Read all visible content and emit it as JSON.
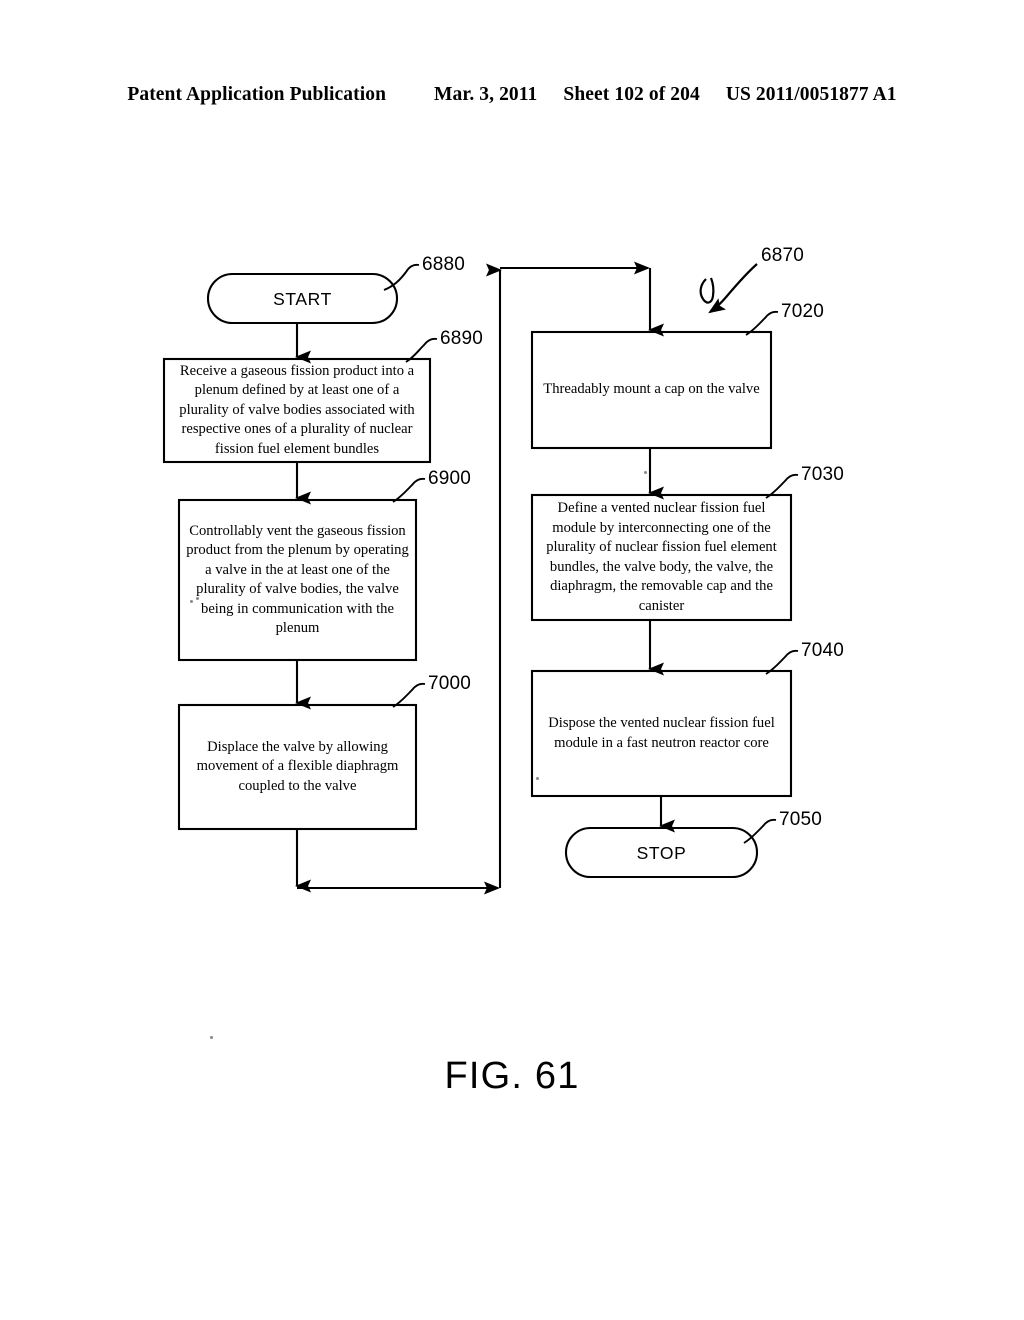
{
  "header": {
    "publication": "Patent Application Publication",
    "date": "Mar. 3, 2011",
    "sheet": "Sheet 102 of 204",
    "number": "US 2011/0051877 A1"
  },
  "figure": {
    "caption": "FIG. 61",
    "overall_ref": "6870"
  },
  "flowchart": {
    "nodes": [
      {
        "id": "start",
        "ref": "6880",
        "shape": "terminator",
        "text": "START"
      },
      {
        "id": "receive-gaseous-fission-product",
        "ref": "6890",
        "shape": "process",
        "text": "Receive a gaseous fission product into a plenum defined by at least one of a plurality of valve bodies associated with respective ones of a plurality of nuclear fission fuel element bundles"
      },
      {
        "id": "controllably-vent",
        "ref": "6900",
        "shape": "process",
        "text": "Controllably vent the gaseous fission product from the plenum by operating a valve in the at least one of the plurality of valve bodies, the valve being in communication with the plenum"
      },
      {
        "id": "displace-valve",
        "ref": "7000",
        "shape": "process",
        "text": "Displace the valve by allowing movement of a flexible diaphragm coupled to the valve"
      },
      {
        "id": "threadably-mount-cap",
        "ref": "7020",
        "shape": "process",
        "text": "Threadably mount a cap on the valve"
      },
      {
        "id": "define-vented-module",
        "ref": "7030",
        "shape": "process",
        "text": "Define a vented nuclear fission fuel module by interconnecting one of the plurality of nuclear fission fuel element bundles, the valve body, the valve, the diaphragm, the removable cap and the canister"
      },
      {
        "id": "dispose-in-reactor-core",
        "ref": "7040",
        "shape": "process",
        "text": "Dispose the vented nuclear fission fuel module in a fast neutron reactor core"
      },
      {
        "id": "stop",
        "ref": "7050",
        "shape": "terminator",
        "text": "STOP"
      }
    ]
  },
  "colors": {
    "ink": "#000000",
    "page": "#ffffff"
  }
}
